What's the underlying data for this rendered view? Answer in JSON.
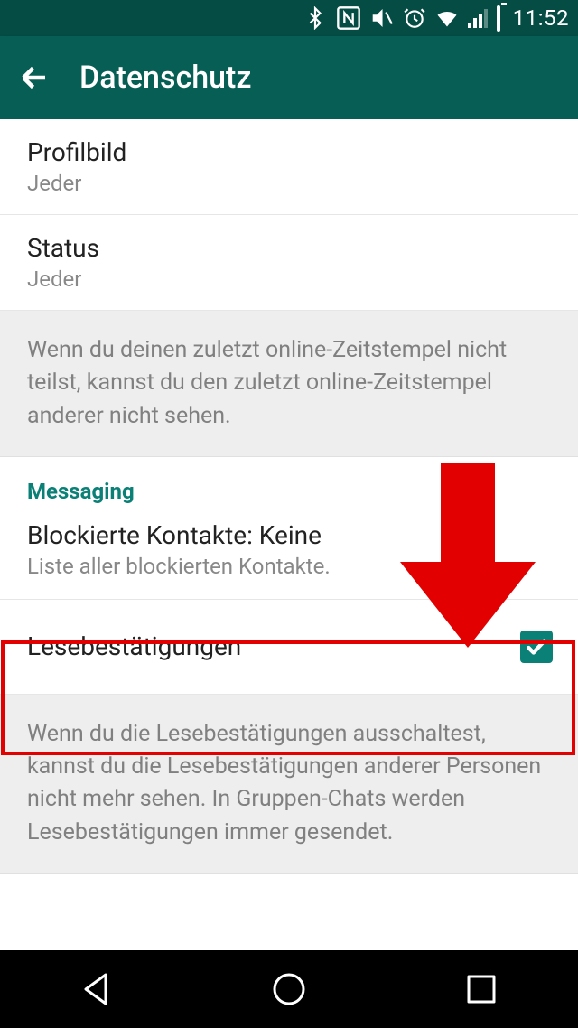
{
  "status": {
    "time": "11:52"
  },
  "appbar": {
    "title": "Datenschutz"
  },
  "items": {
    "profile": {
      "title": "Profilbild",
      "value": "Jeder"
    },
    "status": {
      "title": "Status",
      "value": "Jeder"
    }
  },
  "info1": "Wenn du deinen zuletzt online-Zeitstempel nicht teilst, kannst du den zuletzt online-Zeitstempel anderer nicht sehen.",
  "section": {
    "messaging": "Messaging"
  },
  "blocked": {
    "title": "Blockierte Kontakte: Keine",
    "subtitle": "Liste aller blockierten Kontakte."
  },
  "readreceipts": {
    "title": "Lesebestätigungen",
    "checked": true
  },
  "info2": "Wenn du die Lesebestätigungen ausschaltest, kannst du die Lesebestätigungen anderer Personen nicht mehr sehen. In Gruppen-Chats werden Lesebestätigungen immer gesendet."
}
